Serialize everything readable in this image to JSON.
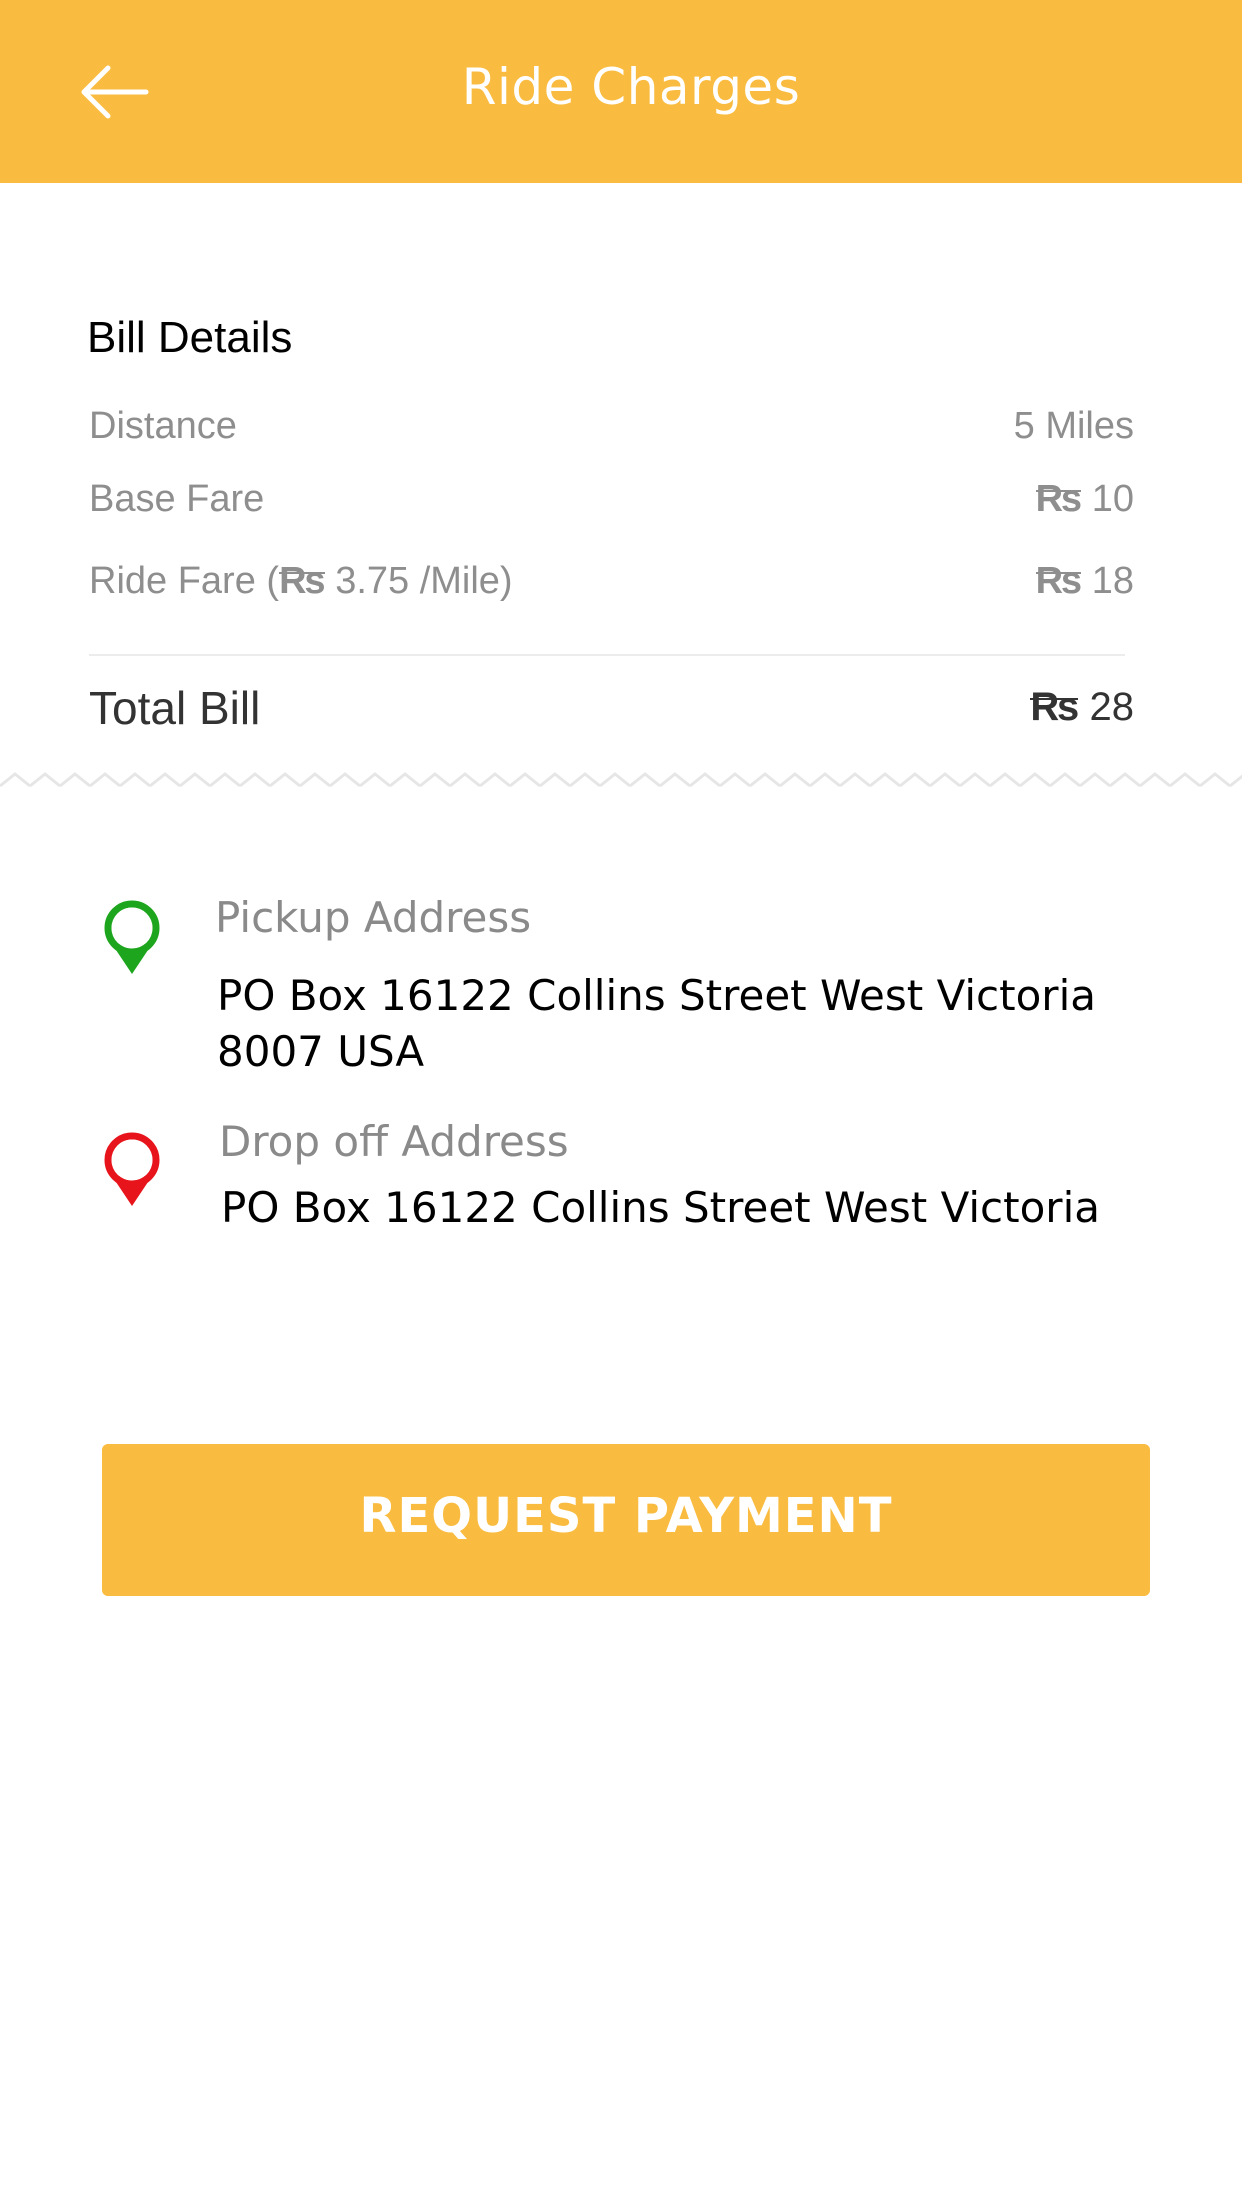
{
  "header": {
    "title": "Ride Charges",
    "back_icon": "arrow-left-icon"
  },
  "bill": {
    "title": "Bill Details",
    "currency_symbol": "₨",
    "rows": [
      {
        "label": "Distance",
        "value": "5 Miles"
      },
      {
        "label": "Base Fare",
        "value": "10"
      },
      {
        "label_prefix": "Ride Fare (",
        "label_rate": "3.75 /Mile)",
        "value": "18"
      }
    ],
    "total_label": "Total Bill",
    "total_value": "28"
  },
  "pickup": {
    "icon": "map-pin-icon",
    "icon_color": "#1ea51e",
    "label": "Pickup Address",
    "address": "PO Box 16122 Collins Street West Victoria 8007 USA"
  },
  "dropoff": {
    "icon": "map-pin-icon",
    "icon_color": "#e8141b",
    "label": "Drop off Address",
    "address": "PO Box 16122 Collins Street West Victoria"
  },
  "action": {
    "label": "REQUEST PAYMENT"
  },
  "colors": {
    "accent": "#f9bc41",
    "muted_text": "#8e8e8e"
  }
}
